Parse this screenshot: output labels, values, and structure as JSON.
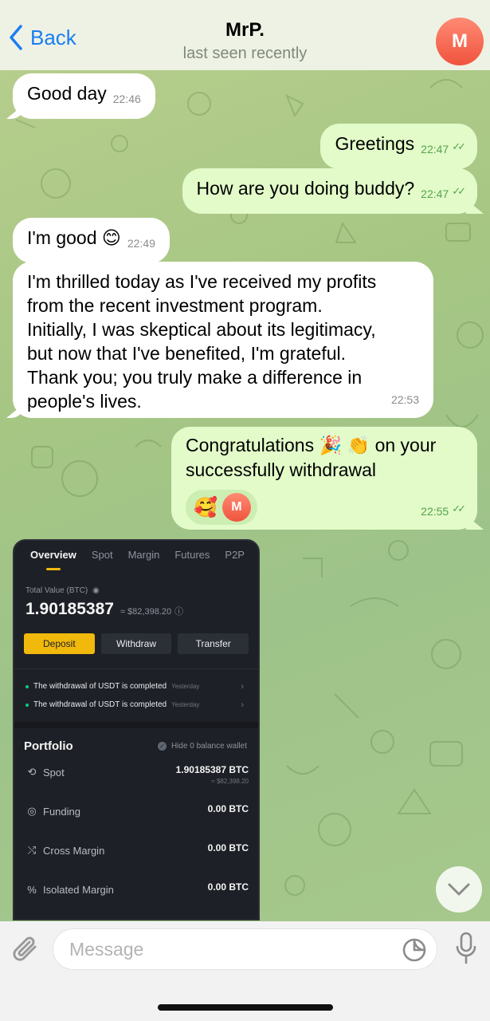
{
  "header": {
    "back_label": "Back",
    "title": "MrP.",
    "subtitle": "last seen recently",
    "avatar_initial": "M"
  },
  "messages": [
    {
      "direction": "in",
      "text": "Good day",
      "time": "22:46"
    },
    {
      "direction": "out",
      "text": "Greetings",
      "time": "22:47"
    },
    {
      "direction": "out",
      "text": "How are you doing buddy?",
      "time": "22:47"
    },
    {
      "direction": "in",
      "text": "I'm good",
      "emoji": "😊",
      "time": "22:49"
    },
    {
      "direction": "in",
      "lines": [
        "I'm thrilled today as I've received my profits",
        "from the recent investment program.",
        "Initially, I was skeptical about its legitimacy,",
        "but now that I've benefited, I'm grateful.",
        "Thank you; you truly make a difference in",
        "people's lives."
      ],
      "time": "22:53"
    },
    {
      "direction": "out",
      "line1_a": "Congratulations",
      "emoji1": "🎉",
      "emoji2": "👏",
      "line1_b": "on your",
      "line2": "successfully withdrawal",
      "reaction": "🥰",
      "reaction_avatar": "M",
      "time": "22:55"
    }
  ],
  "ticks": "✓✓",
  "exchange": {
    "tabs": [
      "Overview",
      "Spot",
      "Margin",
      "Futures",
      "P2P"
    ],
    "total_label": "Total Value (BTC)",
    "total_btc": "1.90185387",
    "total_usd": "≈ $82,398.20",
    "buttons": [
      "Deposit",
      "Withdraw",
      "Transfer"
    ],
    "notices": [
      {
        "text": "The withdrawal of USDT is completed",
        "ago": "Yesterday"
      },
      {
        "text": "The withdrawal of USDT is completed",
        "ago": "Yesterday"
      }
    ],
    "portfolio_title": "Portfolio",
    "hide_label": "Hide 0 balance wallet",
    "rows": [
      {
        "name": "Spot",
        "amount": "1.90185387 BTC",
        "sub": "≈ $82,398.20"
      },
      {
        "name": "Funding",
        "amount": "0.00 BTC"
      },
      {
        "name": "Cross Margin",
        "amount": "0.00 BTC"
      },
      {
        "name": "Isolated Margin",
        "amount": "0.00 BTC"
      }
    ]
  },
  "input": {
    "placeholder": "Message"
  },
  "colors": {
    "link_blue": "#1a7ef2",
    "out_bubble": "#e2fbc9",
    "in_bubble": "#ffffff",
    "exchange_accent": "#f0b90b"
  }
}
